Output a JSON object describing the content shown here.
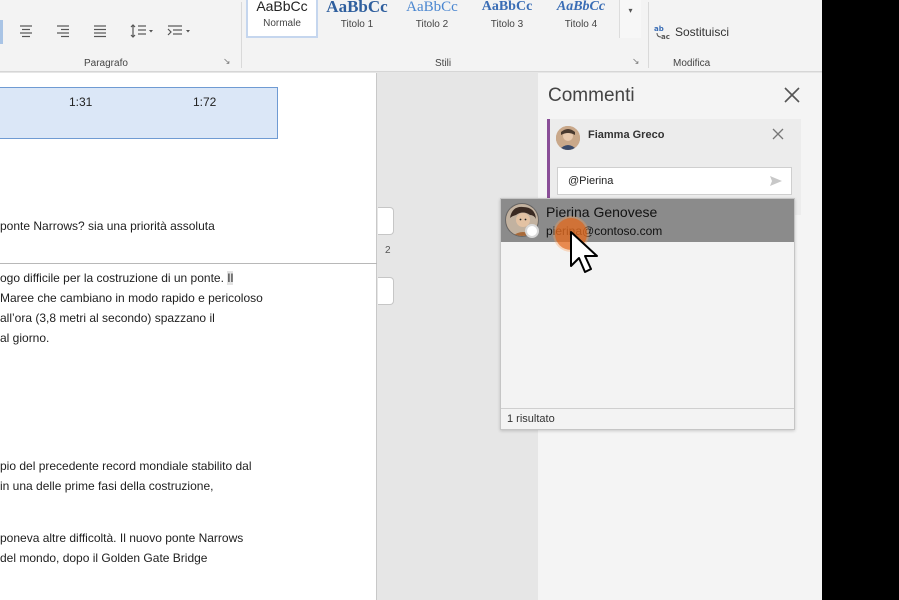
{
  "ribbon": {
    "paragraph_group_label": "Paragrafo",
    "styles_group_label": "Stili",
    "edit_group_label": "Modifica",
    "replace_label": "Sostituisci",
    "styles": [
      {
        "sample": "AaBbCc",
        "name": "Normale"
      },
      {
        "sample": "AaBbCc",
        "name": "Titolo 1"
      },
      {
        "sample": "AaBbCc",
        "name": "Titolo 2"
      },
      {
        "sample": "AaBbCc",
        "name": "Titolo 3"
      },
      {
        "sample": "AaBbCc",
        "name": "Titolo 4"
      }
    ],
    "launcher_glyph": "↘",
    "more_glyph": "▾"
  },
  "document": {
    "table_cells": [
      "1:31",
      "1:72"
    ],
    "lines_top": [
      "ponte Narrows? sia una priorità assoluta"
    ],
    "line_with_highlight": {
      "before": "ogo difficile per la costruzione di un ponte. ",
      "highlight": "Il"
    },
    "lines_mid": [
      "Maree che cambiano in modo rapido e pericoloso",
      "all’ora (3,8 metri al secondo) spazzano il",
      "al giorno."
    ],
    "lines_bottom_a": [
      "pio del precedente record mondiale stabilito dal",
      "in una delle prime fasi della costruzione,"
    ],
    "lines_bottom_b": [
      "poneva altre difficoltà. Il nuovo ponte Narrows",
      "del mondo, dopo il Golden Gate Bridge"
    ],
    "page_number": "2"
  },
  "comments": {
    "title": "Commenti",
    "author": "Fiamma Greco",
    "input_value": "@Pierina",
    "suggestion": {
      "name": "Pierina Genovese",
      "email": "pierina@contoso.com"
    },
    "results": "1 risultato"
  },
  "colors": {
    "comment_accent": "#8a4f98",
    "selection_gray": "#8b8b8b",
    "click_indicator": "#e46c20",
    "heading_blue": "#3a6db5"
  }
}
